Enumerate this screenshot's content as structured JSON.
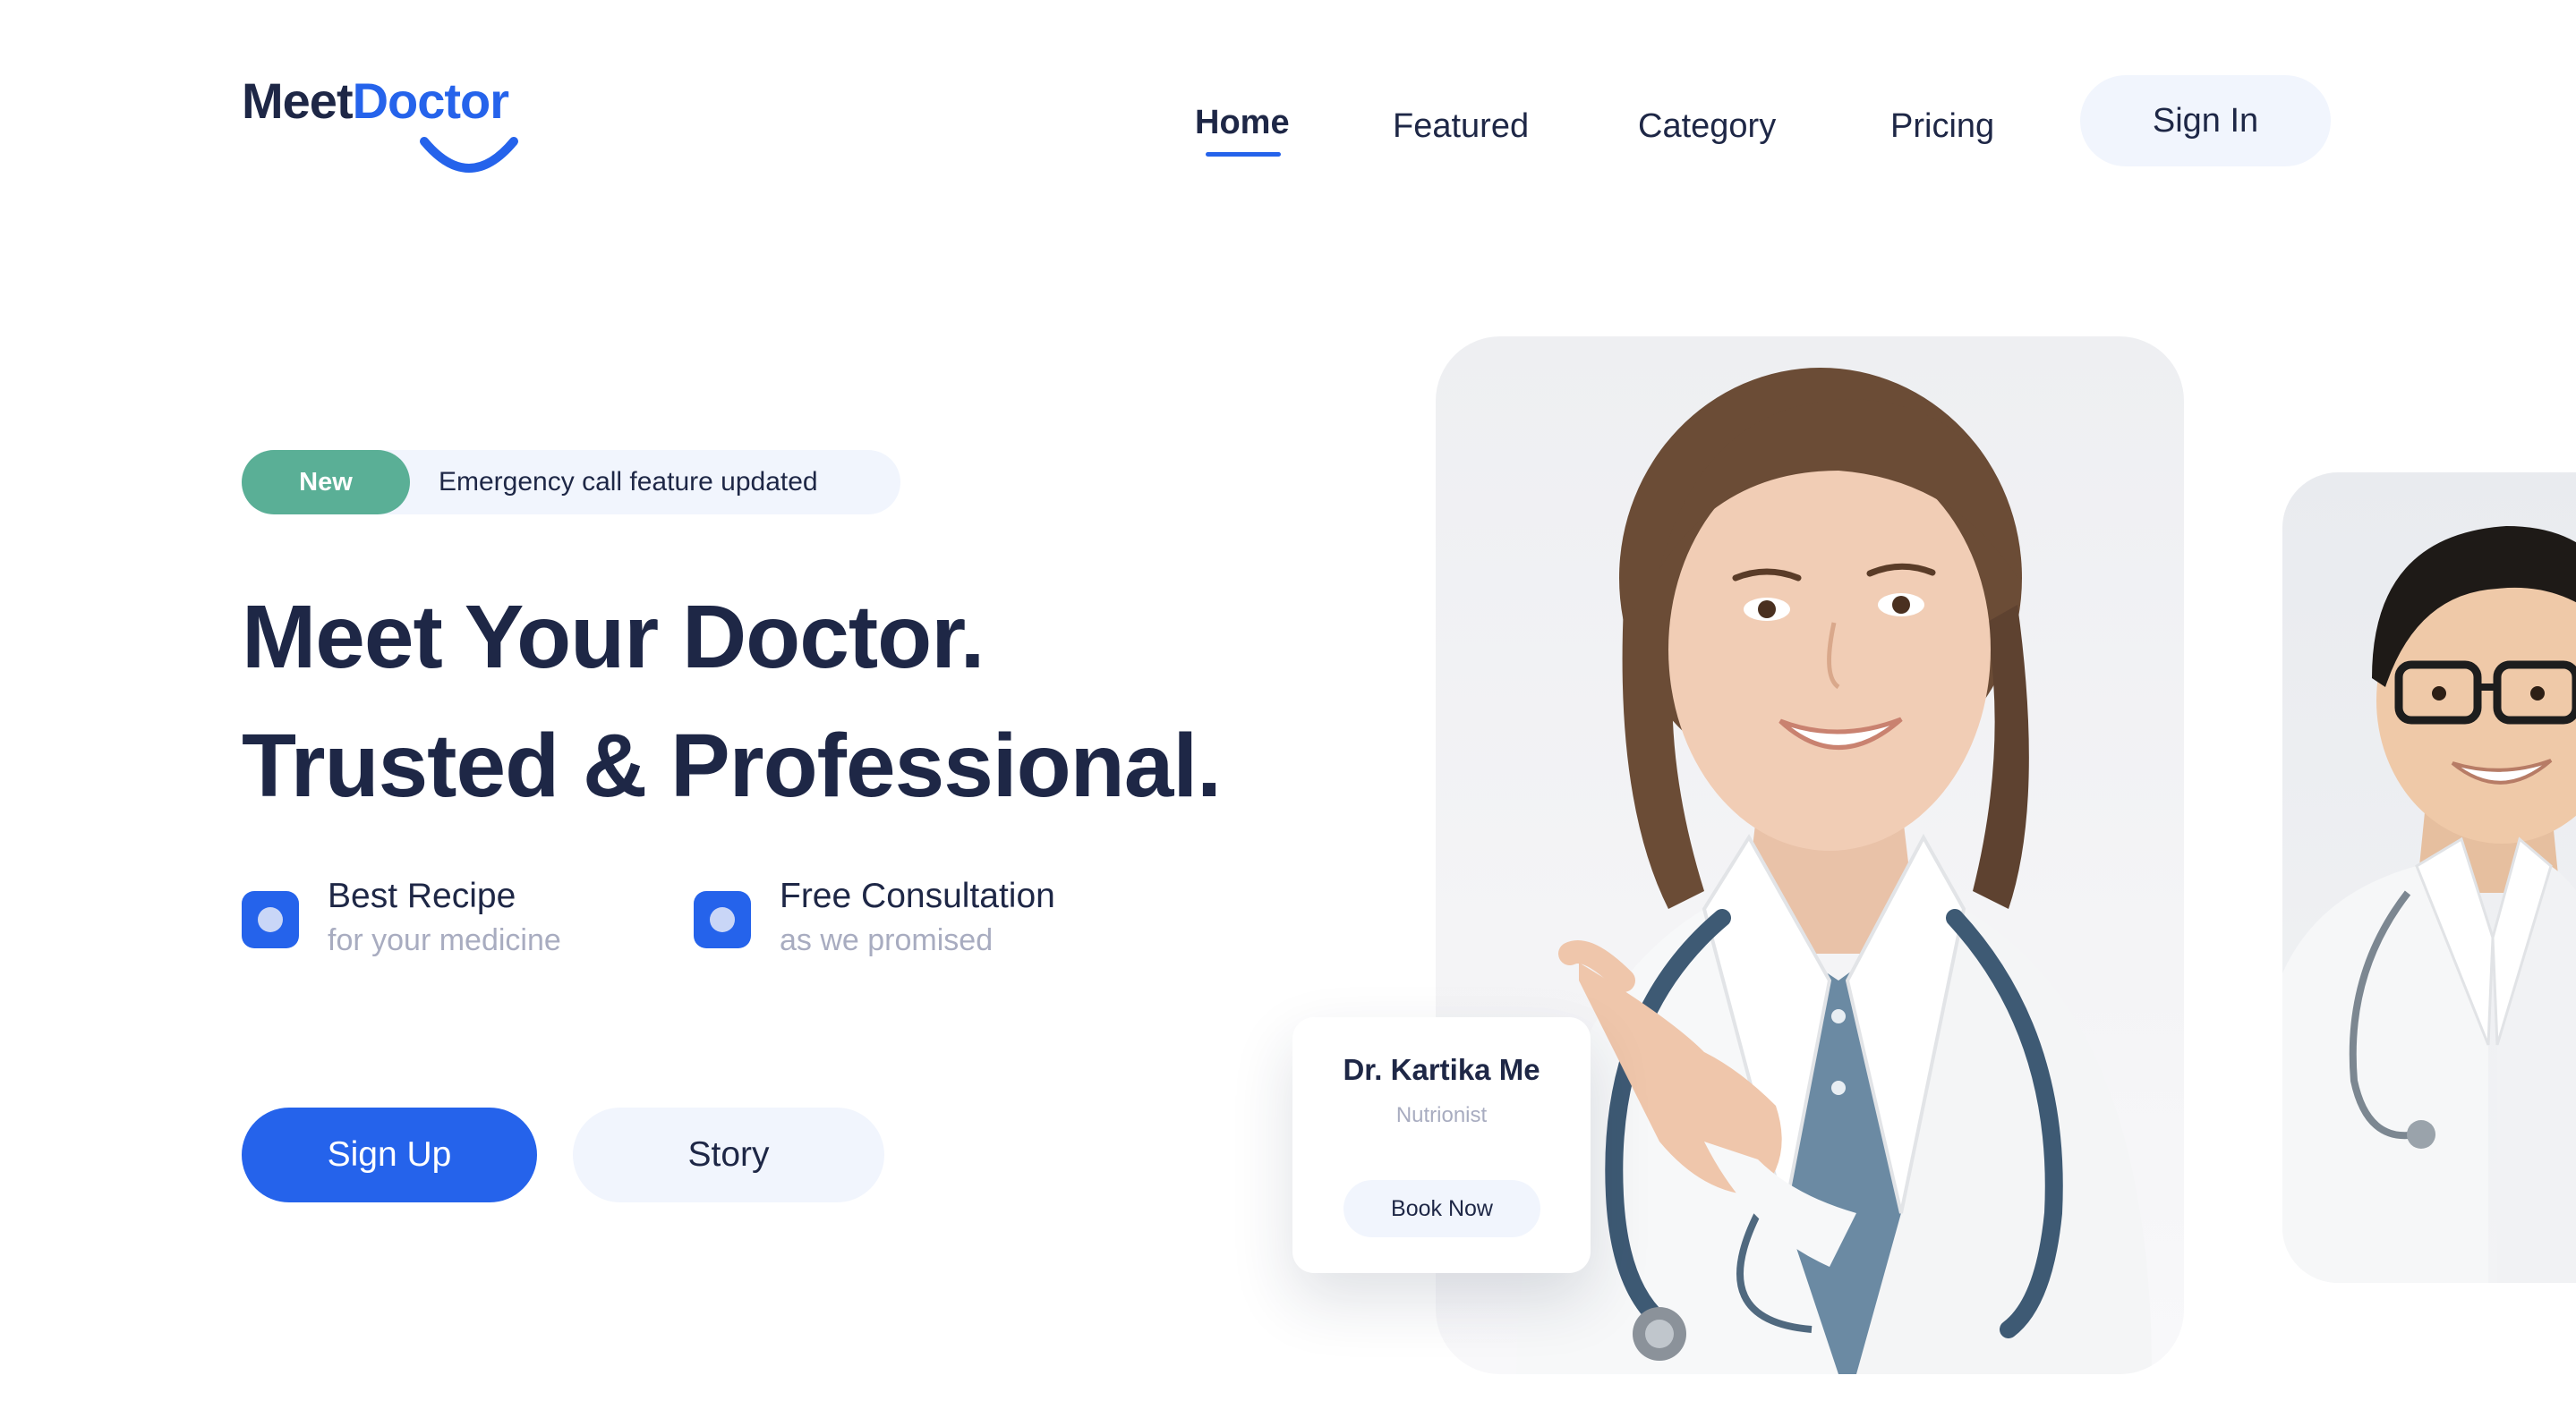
{
  "brand": {
    "part1": "Meet",
    "part2": "Doctor",
    "accent_color": "#2563eb",
    "text_color": "#1e2746"
  },
  "nav": {
    "items": [
      {
        "label": "Home",
        "active": true
      },
      {
        "label": "Featured",
        "active": false
      },
      {
        "label": "Category",
        "active": false
      },
      {
        "label": "Pricing",
        "active": false
      }
    ],
    "signin_label": "Sign In"
  },
  "announcement": {
    "badge": "New",
    "text": "Emergency call feature updated",
    "badge_color": "#5aaf96"
  },
  "hero": {
    "line1": "Meet Your Doctor.",
    "line2": "Trusted & Professional."
  },
  "features": [
    {
      "title": "Best Recipe",
      "subtitle": "for your medicine"
    },
    {
      "title": "Free Consultation",
      "subtitle": "as we promised"
    }
  ],
  "cta": {
    "primary": "Sign Up",
    "secondary": "Story"
  },
  "doctor_card": {
    "name": "Dr. Kartika Me",
    "role": "Nutrionist",
    "button": "Book Now"
  },
  "icons": [
    "smile-logo-icon",
    "feature-recipe-icon",
    "feature-consultation-icon"
  ]
}
